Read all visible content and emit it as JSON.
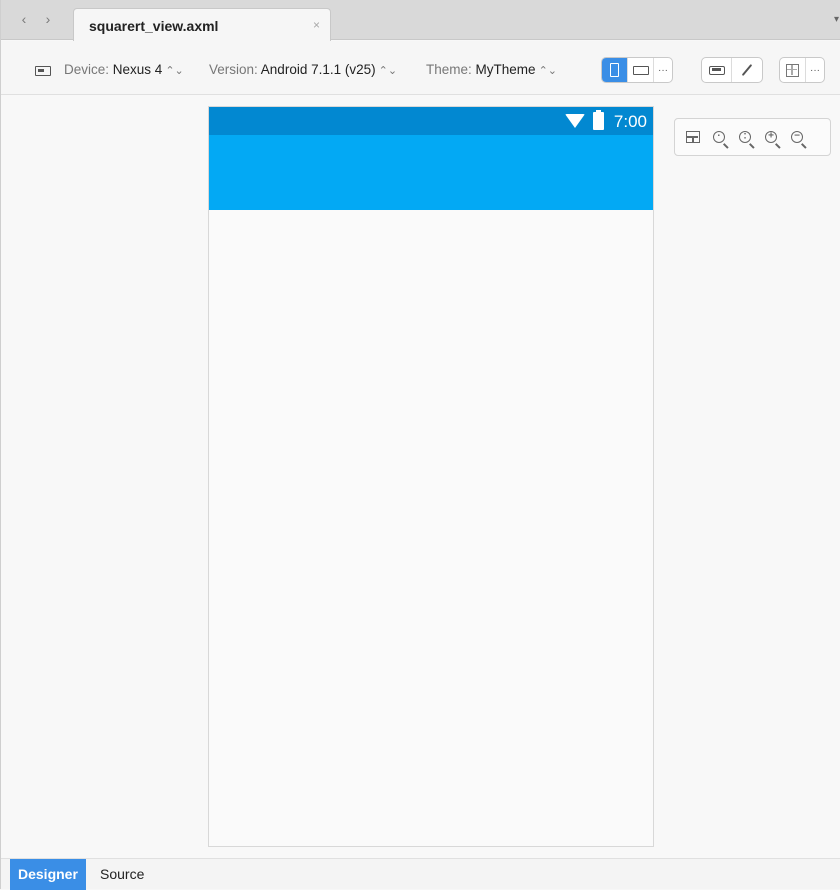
{
  "tab": {
    "title": "squarert_view.axml",
    "close": "×"
  },
  "nav": {
    "back": "‹",
    "forward": "›",
    "overflow": "▾"
  },
  "toolbar": {
    "device_label": "Device:",
    "device_value": "Nexus 4",
    "version_label": "Version:",
    "version_value": "Android 7.1.1 (v25)",
    "theme_label": "Theme:",
    "theme_value": "MyTheme",
    "spin": "⌃⌄",
    "more": "···"
  },
  "phone": {
    "time": "7:00",
    "statusbar_color": "#0288d1",
    "actionbar_color": "#03a9f4"
  },
  "bottom_tabs": {
    "designer": "Designer",
    "source": "Source"
  }
}
